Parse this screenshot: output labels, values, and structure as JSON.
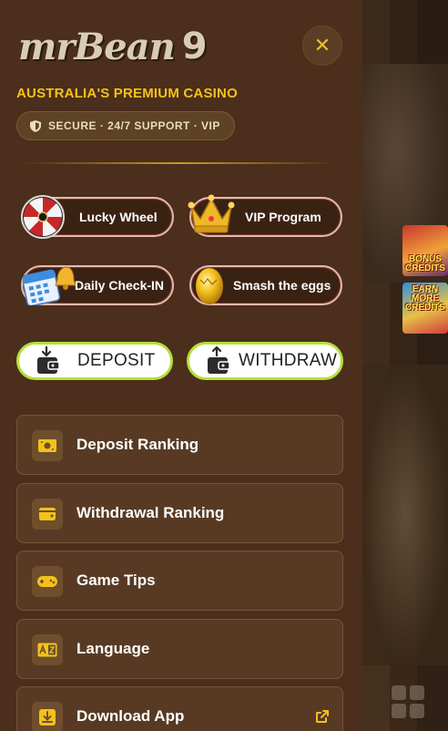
{
  "brand": {
    "logo_text": "mrBean",
    "logo_digit": "9"
  },
  "header": {
    "close_symbol": "✕",
    "tagline": "AUSTRALIA'S PREMIUM CASINO",
    "secure_text": "SECURE · 24/7 SUPPORT · VIP"
  },
  "promos": {
    "lucky_wheel": "Lucky Wheel",
    "vip_program": "VIP Program",
    "daily_checkin": "Daily Check-IN",
    "smash_eggs": "Smash the eggs"
  },
  "actions": {
    "deposit": "DEPOSIT",
    "withdraw": "WITHDRAW"
  },
  "menu": [
    {
      "label": "Deposit Ranking",
      "icon": "money-icon"
    },
    {
      "label": "Withdrawal Ranking",
      "icon": "wallet-icon"
    },
    {
      "label": "Game Tips",
      "icon": "gamepad-icon"
    },
    {
      "label": "Language",
      "icon": "translate-icon"
    },
    {
      "label": "Download App",
      "icon": "download-icon"
    }
  ],
  "side_tiles": {
    "bonus": "BONUS\nCREDITS",
    "earn": "EARN MORE\nCREDITS"
  },
  "colors": {
    "drawer_bg": "#4b2e1b",
    "accent_gold": "#f2c21a",
    "button_border_green": "#b6df3a",
    "promo_border_pink": "#e8b8b0"
  }
}
